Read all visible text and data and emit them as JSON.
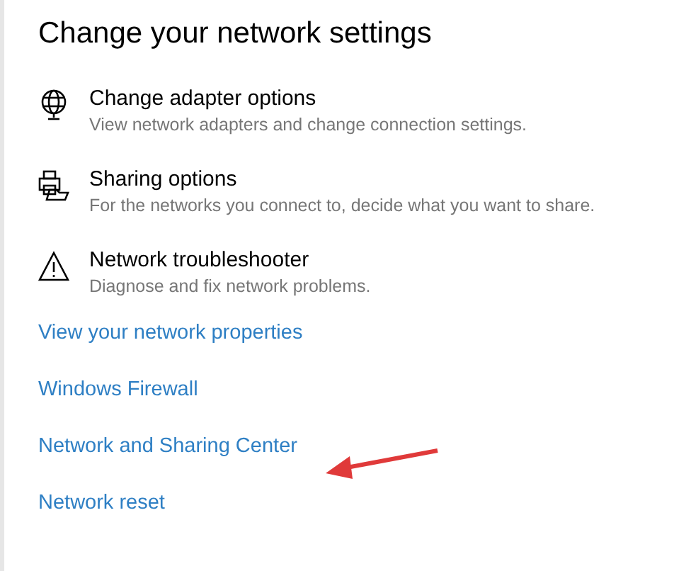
{
  "heading": "Change your network settings",
  "options": [
    {
      "kind": "adapter",
      "title": "Change adapter options",
      "description": "View network adapters and change connection settings."
    },
    {
      "kind": "sharing",
      "title": "Sharing options",
      "description": "For the networks you connect to, decide what you want to share."
    },
    {
      "kind": "troubleshooter",
      "title": "Network troubleshooter",
      "description": "Diagnose and fix network problems."
    }
  ],
  "links": [
    "View your network properties",
    "Windows Firewall",
    "Network and Sharing Center",
    "Network reset"
  ]
}
